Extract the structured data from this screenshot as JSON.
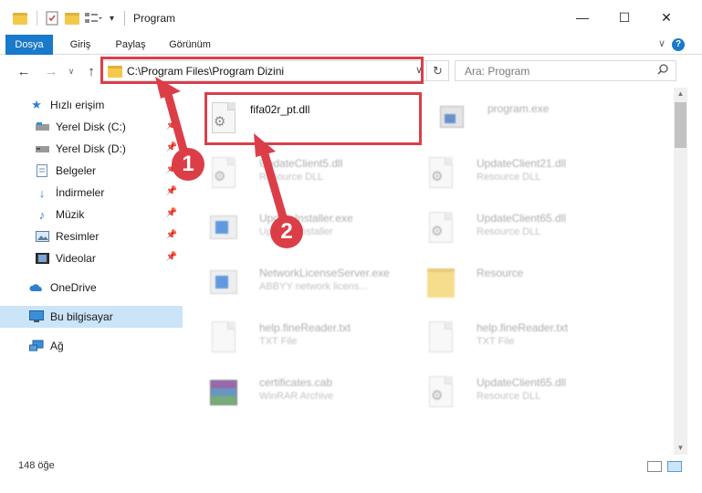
{
  "window": {
    "title": "Program",
    "minimize_glyph": "—",
    "maximize_glyph": "☐",
    "close_glyph": "✕"
  },
  "ribbon": {
    "tabs": [
      "Dosya",
      "Giriş",
      "Paylaş",
      "Görünüm"
    ],
    "help_glyph": "?"
  },
  "address": {
    "path": "C:\\Program Files\\Program Dizini"
  },
  "search": {
    "placeholder": "Ara: Program"
  },
  "sidebar": {
    "items": [
      {
        "label": "Hızlı erişim",
        "icon": "star-icon"
      },
      {
        "label": "Yerel Disk (C:)",
        "icon": "drive-icon"
      },
      {
        "label": "Yerel Disk (D:)",
        "icon": "drive-icon"
      },
      {
        "label": "Belgeler",
        "icon": "documents-icon"
      },
      {
        "label": "İndirmeler",
        "icon": "download-icon"
      },
      {
        "label": "Müzik",
        "icon": "music-icon"
      },
      {
        "label": "Resimler",
        "icon": "pictures-icon"
      },
      {
        "label": "Videolar",
        "icon": "videos-icon"
      },
      {
        "label": "OneDrive",
        "icon": "cloud-icon"
      },
      {
        "label": "Bu bilgisayar",
        "icon": "computer-icon"
      },
      {
        "label": "Ağ",
        "icon": "network-icon"
      }
    ]
  },
  "files": [
    {
      "name": "fifa02r_pt.dll",
      "desc": "",
      "icon": "dll-icon"
    },
    {
      "name": "program.exe",
      "desc": "",
      "icon": "exe-icon"
    },
    {
      "name": "UpdateClient5.dll",
      "desc": "Resource DLL",
      "icon": "dll-icon"
    },
    {
      "name": "UpdateClient21.dll",
      "desc": "Resource DLL",
      "icon": "dll-icon"
    },
    {
      "name": "UpdateInstaller.exe",
      "desc": "Updater Installer",
      "icon": "window-icon"
    },
    {
      "name": "UpdateClient65.dll",
      "desc": "Resource DLL",
      "icon": "dll-icon"
    },
    {
      "name": "NetworkLicenseServer.exe",
      "desc": "ABBYY network licens...",
      "icon": "window-icon"
    },
    {
      "name": "Resource",
      "desc": "",
      "icon": "folder-icon"
    },
    {
      "name": "help.fineReader.txt",
      "desc": "TXT File",
      "icon": "text-file-icon"
    },
    {
      "name": "help.fineReader.txt",
      "desc": "TXT File",
      "icon": "text-file-icon"
    },
    {
      "name": "certificates.cab",
      "desc": "WinRAR Archive",
      "icon": "archive-icon"
    },
    {
      "name": "UpdateClient65.dll",
      "desc": "Resource DLL",
      "icon": "dll-icon"
    }
  ],
  "annotations": {
    "step1": "1",
    "step2": "2",
    "color": "#dc3e48"
  },
  "status": {
    "item_count": "148 öğe"
  }
}
